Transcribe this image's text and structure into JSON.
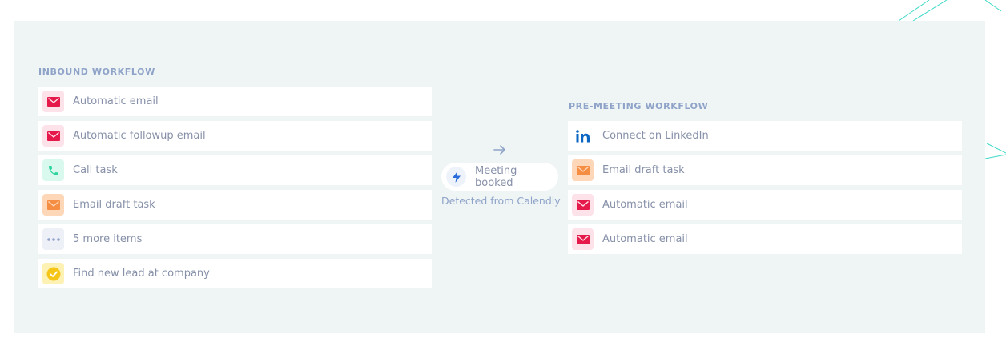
{
  "colors": {
    "panel_bg": "#eff5f5",
    "mail_red": "#e6194b",
    "mail_orange": "#f58d42",
    "phone_green": "#2dd4a0",
    "dots_gray": "#8fa3c9",
    "check_yellow": "#f5c518",
    "linkedin_blue": "#0a66c2",
    "bolt_blue": "#2b6cdb"
  },
  "inbound": {
    "title": "INBOUND WORKFLOW",
    "items": [
      {
        "label": "Automatic email",
        "icon": "mail-red-icon"
      },
      {
        "label": "Automatic followup email",
        "icon": "mail-red-icon"
      },
      {
        "label": "Call task",
        "icon": "phone-icon"
      },
      {
        "label": "Email draft task",
        "icon": "mail-orange-icon"
      },
      {
        "label": "5 more items",
        "icon": "more-dots-icon"
      },
      {
        "label": "Find new lead at company",
        "icon": "check-circle-icon"
      }
    ]
  },
  "trigger": {
    "label": "Meeting booked",
    "detected": "Detected from Calendly",
    "icon": "lightning-bolt-icon",
    "arrow_icon": "arrow-right-icon"
  },
  "premeeting": {
    "title": "PRE-MEETING WORKFLOW",
    "items": [
      {
        "label": "Connect on LinkedIn",
        "icon": "linkedin-icon"
      },
      {
        "label": "Email draft task",
        "icon": "mail-orange-icon"
      },
      {
        "label": "Automatic email",
        "icon": "mail-red-icon"
      },
      {
        "label": "Automatic email",
        "icon": "mail-red-icon"
      }
    ]
  }
}
